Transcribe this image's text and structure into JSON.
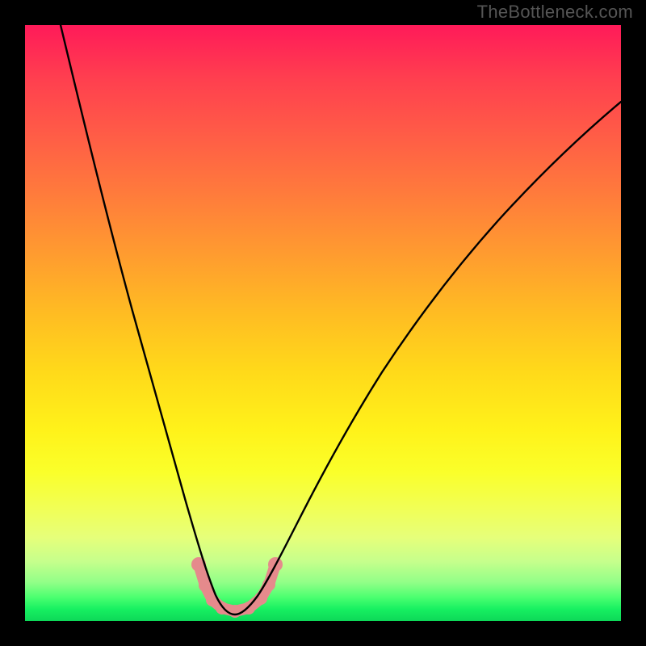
{
  "watermark": "TheBottleneck.com",
  "chart_data": {
    "type": "line",
    "title": "",
    "xlabel": "",
    "ylabel": "",
    "xlim": [
      0,
      100
    ],
    "ylim": [
      0,
      100
    ],
    "grid": false,
    "legend": false,
    "series": [
      {
        "name": "bottleneck-curve",
        "color": "#000000",
        "x": [
          6,
          10,
          14,
          18,
          22,
          25,
          27,
          29,
          30.5,
          32,
          33.5,
          35,
          37,
          39,
          41,
          44,
          48,
          53,
          58,
          64,
          70,
          76,
          83,
          90,
          100
        ],
        "values": [
          100,
          83,
          67,
          52,
          38,
          27,
          20,
          13,
          8,
          4.5,
          2.3,
          1.5,
          1.5,
          2.5,
          4.5,
          8,
          14,
          22,
          31,
          41,
          50,
          59,
          67,
          74,
          83
        ]
      }
    ],
    "ideal_zone": {
      "description": "Pink marker along curve bottom indicating low-bottleneck range",
      "x_range": [
        29,
        41
      ],
      "y_max": 8,
      "color": "#e58a8c"
    },
    "background_gradient": {
      "orientation": "vertical",
      "stops": [
        {
          "pos": 0.0,
          "color": "#ff1a59"
        },
        {
          "pos": 0.5,
          "color": "#ffd91a"
        },
        {
          "pos": 0.8,
          "color": "#f1ff55"
        },
        {
          "pos": 1.0,
          "color": "#0dd858"
        }
      ]
    }
  }
}
